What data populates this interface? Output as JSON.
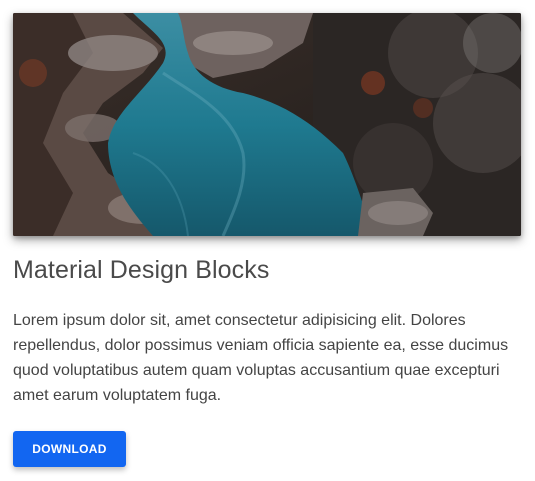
{
  "card": {
    "image": {
      "icon": "river-canyon-photo"
    },
    "title": "Material Design Blocks",
    "body": "Lorem ipsum dolor sit, amet consectetur adipisicing elit. Dolores repellendus, dolor possimus veniam officia sapiente ea, esse ducimus quod voluptatibus autem quam voluptas accusantium quae excepturi amet earum voluptatem fuga.",
    "button_label": "DOWNLOAD"
  },
  "colors": {
    "button": "#1266f1",
    "title": "#4a4a4a",
    "text": "#444444"
  }
}
